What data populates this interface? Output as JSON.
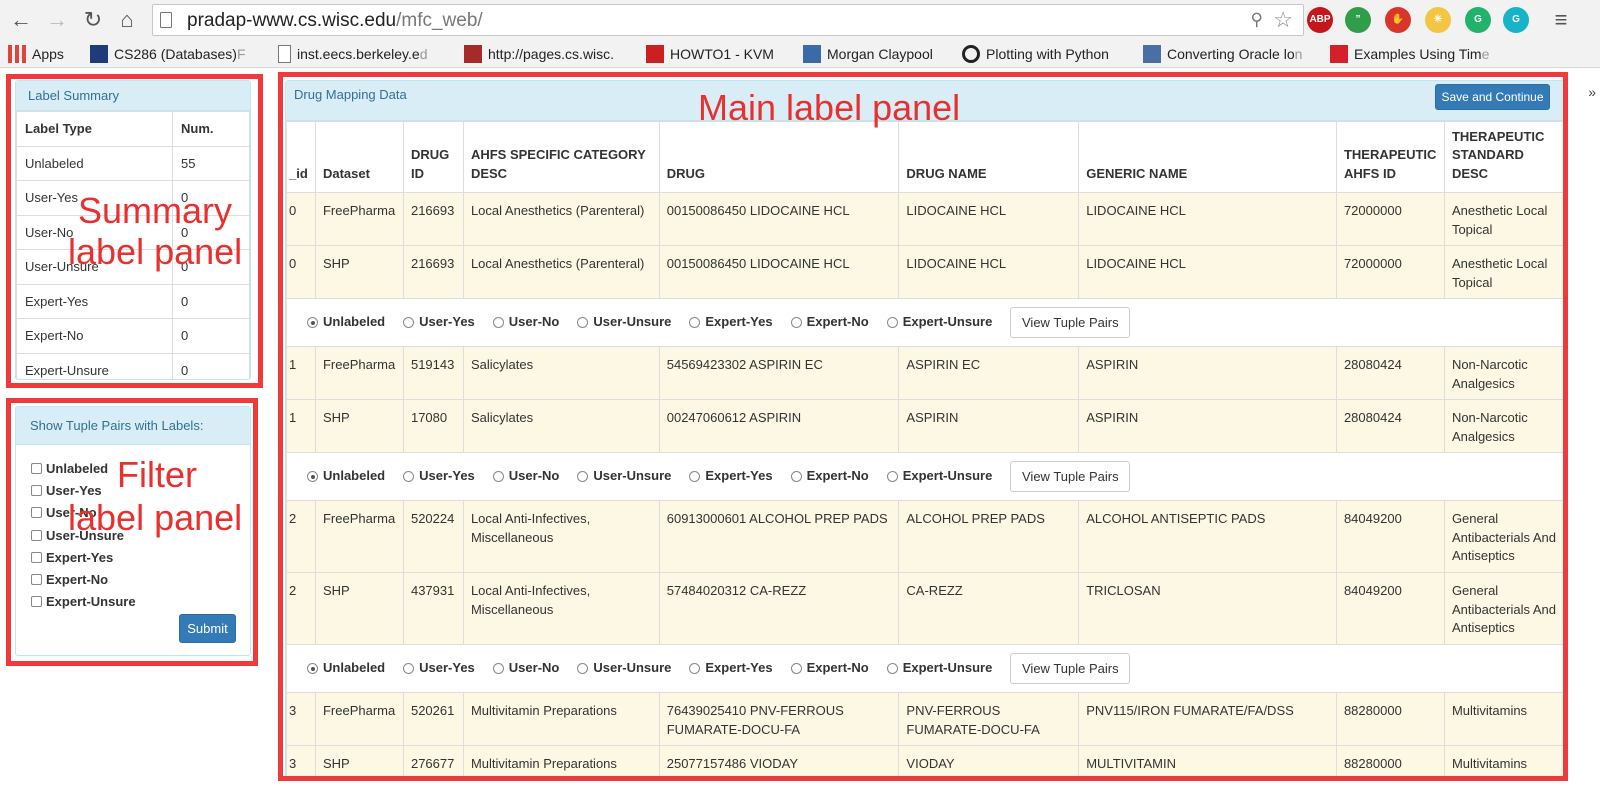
{
  "browser": {
    "url_host": "pradap-www.cs.wisc.edu",
    "url_path": "/mfc_web/",
    "extensions": [
      {
        "label": "ABP",
        "color": "#c4161c"
      },
      {
        "label": "”",
        "color": "#2e9e4a"
      },
      {
        "label": "✋",
        "color": "#d9362b"
      },
      {
        "label": "✳",
        "color": "#f2c643"
      },
      {
        "label": "G",
        "color": "#22b26c"
      },
      {
        "label": "G",
        "color": "#19b3c7"
      }
    ],
    "bookmarks": [
      {
        "text": "Apps",
        "icon": "apps-grid-icon",
        "fade": ""
      },
      {
        "text": "CS286 (Databases) ",
        "icon": "university-logo-icon",
        "fade": "F"
      },
      {
        "text": "inst.eecs.berkeley.e",
        "icon": "page-icon",
        "fade": "d"
      },
      {
        "text": "http://pages.cs.wisc.",
        "icon": "wisc-crest-icon",
        "fade": ""
      },
      {
        "text": "HOWTO1 - KVM",
        "icon": "redhat-icon",
        "fade": ""
      },
      {
        "text": "Morgan Claypool",
        "icon": "mc-logo-icon",
        "fade": ""
      },
      {
        "text": "Plotting with Python",
        "icon": "circle-o-icon",
        "fade": ""
      },
      {
        "text": "Converting Oracle lo",
        "icon": "bc-logo-icon",
        "fade": "n"
      },
      {
        "text": "Examples Using Tim",
        "icon": "oracle-icon",
        "fade": "e"
      }
    ],
    "bookmarks_more": "»"
  },
  "summary_panel": {
    "title": "Label Summary",
    "header": [
      "Label Type",
      "Num."
    ],
    "rows": [
      [
        "Unlabeled",
        "55"
      ],
      [
        "User-Yes",
        "0"
      ],
      [
        "User-No",
        "0"
      ],
      [
        "User-Unsure",
        "0"
      ],
      [
        "Expert-Yes",
        "0"
      ],
      [
        "Expert-No",
        "0"
      ],
      [
        "Expert-Unsure",
        "0"
      ]
    ]
  },
  "filter_panel": {
    "title": "Show Tuple Pairs with Labels:",
    "options": [
      "Unlabeled",
      "User-Yes",
      "User-No",
      "User-Unsure",
      "Expert-Yes",
      "Expert-No",
      "Expert-Unsure"
    ],
    "submit": "Submit"
  },
  "main_panel": {
    "title": "Drug Mapping Data",
    "save_button": "Save and Continue",
    "columns": [
      "_id",
      "Dataset",
      "DRUG ID",
      "AHFS SPECIFIC CATEGORY DESC",
      "DRUG",
      "DRUG NAME",
      "GENERIC NAME",
      "THERAPEUTIC AHFS ID",
      "THERAPEUTIC STANDARD DESC"
    ],
    "label_options": [
      "Unlabeled",
      "User-Yes",
      "User-No",
      "User-Unsure",
      "Expert-Yes",
      "Expert-No",
      "Expert-Unsure"
    ],
    "view_button": "View Tuple Pairs",
    "pairs": [
      {
        "selected": "Unlabeled",
        "rows": [
          [
            "0",
            "FreePharma",
            "216693",
            "Local Anesthetics (Parenteral)",
            "00150086450 LIDOCAINE HCL",
            "LIDOCAINE HCL",
            "LIDOCAINE HCL",
            "72000000",
            "Anesthetic Local Topical"
          ],
          [
            "0",
            "SHP",
            "216693",
            "Local Anesthetics (Parenteral)",
            "00150086450 LIDOCAINE HCL",
            "LIDOCAINE HCL",
            "LIDOCAINE HCL",
            "72000000",
            "Anesthetic Local Topical"
          ]
        ]
      },
      {
        "selected": "Unlabeled",
        "rows": [
          [
            "1",
            "FreePharma",
            "519143",
            "Salicylates",
            "54569423302 ASPIRIN EC",
            "ASPIRIN EC",
            "ASPIRIN",
            "28080424",
            "Non-Narcotic Analgesics"
          ],
          [
            "1",
            "SHP",
            "17080",
            "Salicylates",
            "00247060612 ASPIRIN",
            "ASPIRIN",
            "ASPIRIN",
            "28080424",
            "Non-Narcotic Analgesics"
          ]
        ]
      },
      {
        "selected": "Unlabeled",
        "rows": [
          [
            "2",
            "FreePharma",
            "520224",
            "Local Anti-Infectives, Miscellaneous",
            "60913000601 ALCOHOL PREP PADS",
            "ALCOHOL PREP PADS",
            "ALCOHOL ANTISEPTIC PADS",
            "84049200",
            "General Antibacterials And Antiseptics"
          ],
          [
            "2",
            "SHP",
            "437931",
            "Local Anti-Infectives, Miscellaneous",
            "57484020312 CA-REZZ",
            "CA-REZZ",
            "TRICLOSAN",
            "84049200",
            "General Antibacterials And Antiseptics"
          ]
        ]
      },
      {
        "selected": "Unlabeled",
        "rows": [
          [
            "3",
            "FreePharma",
            "520261",
            "Multivitamin Preparations",
            "76439025410 PNV-FERROUS FUMARATE-DOCU-FA",
            "PNV-FERROUS FUMARATE-DOCU-FA",
            "PNV115/IRON FUMARATE/FA/DSS",
            "88280000",
            "Multivitamins"
          ],
          [
            "3",
            "SHP",
            "276677",
            "Multivitamin Preparations",
            "25077157486 VIODAY",
            "VIODAY",
            "MULTIVITAMIN",
            "88280000",
            "Multivitamins"
          ]
        ]
      }
    ]
  },
  "annotations": {
    "summary": [
      "Summary",
      "label panel"
    ],
    "filter": [
      "Filter",
      "label panel"
    ],
    "main": "Main label panel",
    "color": "#e8312f"
  }
}
